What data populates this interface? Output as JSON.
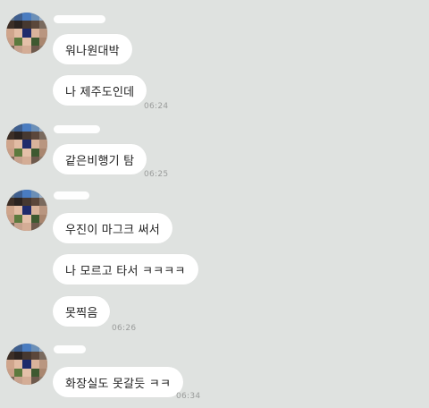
{
  "conversation": {
    "groups": [
      {
        "messages": [
          {
            "text": "워나원대박",
            "time": ""
          },
          {
            "text": "나 제주도인데",
            "time": "06:24"
          }
        ]
      },
      {
        "messages": [
          {
            "text": "같은비행기 탐",
            "time": "06:25"
          }
        ]
      },
      {
        "messages": [
          {
            "text": "우진이 마그크 써서",
            "time": ""
          },
          {
            "text": "나 모르고 타서 ㅋㅋㅋㅋ",
            "time": ""
          },
          {
            "text": "못찍음",
            "time": "06:26"
          }
        ]
      },
      {
        "messages": [
          {
            "text": "화장실도 못갈듯 ㅋㅋ",
            "time": "06:34"
          }
        ]
      }
    ]
  },
  "colors": {
    "background": "#dfe2e0",
    "bubble": "#ffffff",
    "timestamp": "#9a9c9b"
  }
}
